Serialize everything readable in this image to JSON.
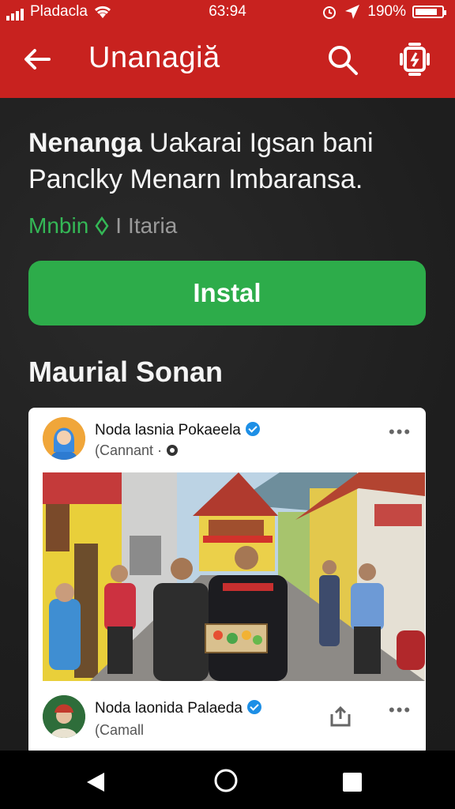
{
  "status_bar": {
    "carrier": "Pladacla",
    "time": "63:94",
    "battery_text": "190%",
    "battery_level": 0.85,
    "icons": [
      "signal-bars-icon",
      "wifi-icon",
      "alarm-icon",
      "location-arrow-icon",
      "battery-icon"
    ]
  },
  "app_bar": {
    "title": "Unanagiă",
    "icons": [
      "back-arrow-icon",
      "search-icon",
      "settings-gear-icon"
    ]
  },
  "app": {
    "headline_bold": "Nenanga",
    "headline_rest": " Uakarai Igsan bani Panclky Menarn Imbaransa.",
    "developer": "Mnbin",
    "developer_icon": "leaf-icon",
    "separator": "I",
    "category": "Itaria",
    "install_label": "Instal"
  },
  "section": {
    "title": "Maurial Sonan"
  },
  "posts": [
    {
      "name": "Noda lasnia Pokaeela",
      "sub": "(Cannant",
      "sub_icon": "clock-icon",
      "more": "•••",
      "verified": true
    },
    {
      "name": "Noda laonida Palaeda",
      "sub": "(Camall",
      "more": "•••",
      "verified": true,
      "action_icon": "share-icon"
    }
  ],
  "colors": {
    "brand_red": "#c8221f",
    "install_green": "#2dac4a",
    "developer_green": "#34b856",
    "verified_blue": "#1d8fe6"
  },
  "nav_bar": {
    "icons": [
      "nav-back-icon",
      "nav-home-icon",
      "nav-recents-icon"
    ]
  }
}
